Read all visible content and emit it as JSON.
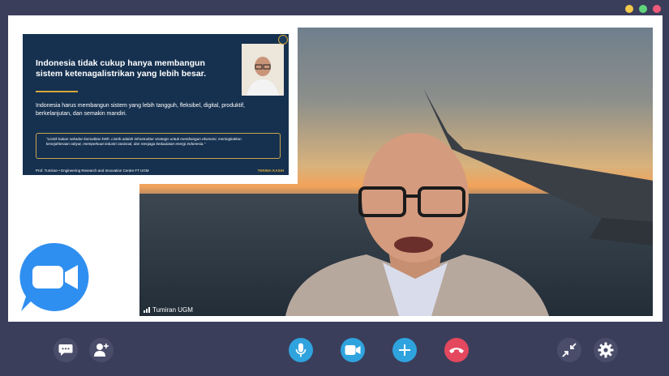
{
  "window": {
    "controls": [
      "minimize",
      "maximize",
      "close"
    ]
  },
  "slide": {
    "title": "Indonesia tidak cukup hanya membangun sistem ketenagalistrikan yang lebih besar.",
    "body": "Indonesia harus membangun sistem yang lebih tangguh, fleksibel, digital, produktif, berkelanjutan, dan semakin mandiri.",
    "quote": "\"Listrik bukan sekadar komoditas kWh. Listrik adalah infrastruktur strategis untuk membangun ekonomi, meningkatkan kesejahteraan rakyat, memperkuat industri nasional, dan menjaga kedaulatan energi Indonesia.\"",
    "footer": "Prof. Tumiran  •  Engineering Research and Innovation Centre FT UGM",
    "thanks": "TERIMA KASIH"
  },
  "video": {
    "participant_name": "Tumiran UGM"
  },
  "toolbar": {
    "chat_icon": "chat-icon",
    "add_participant_icon": "add-user-icon",
    "mic_icon": "microphone-icon",
    "camera_icon": "video-camera-icon",
    "plus_icon": "plus-icon",
    "end_call_icon": "end-call-icon",
    "minimize_icon": "collapse-arrows-icon",
    "settings_icon": "gear-icon"
  },
  "colors": {
    "background": "#3b3e5b",
    "accent_blue": "#2fa3de",
    "end_call_red": "#e4485e",
    "slide_navy": "#163150",
    "slide_gold": "#d5a73a"
  }
}
